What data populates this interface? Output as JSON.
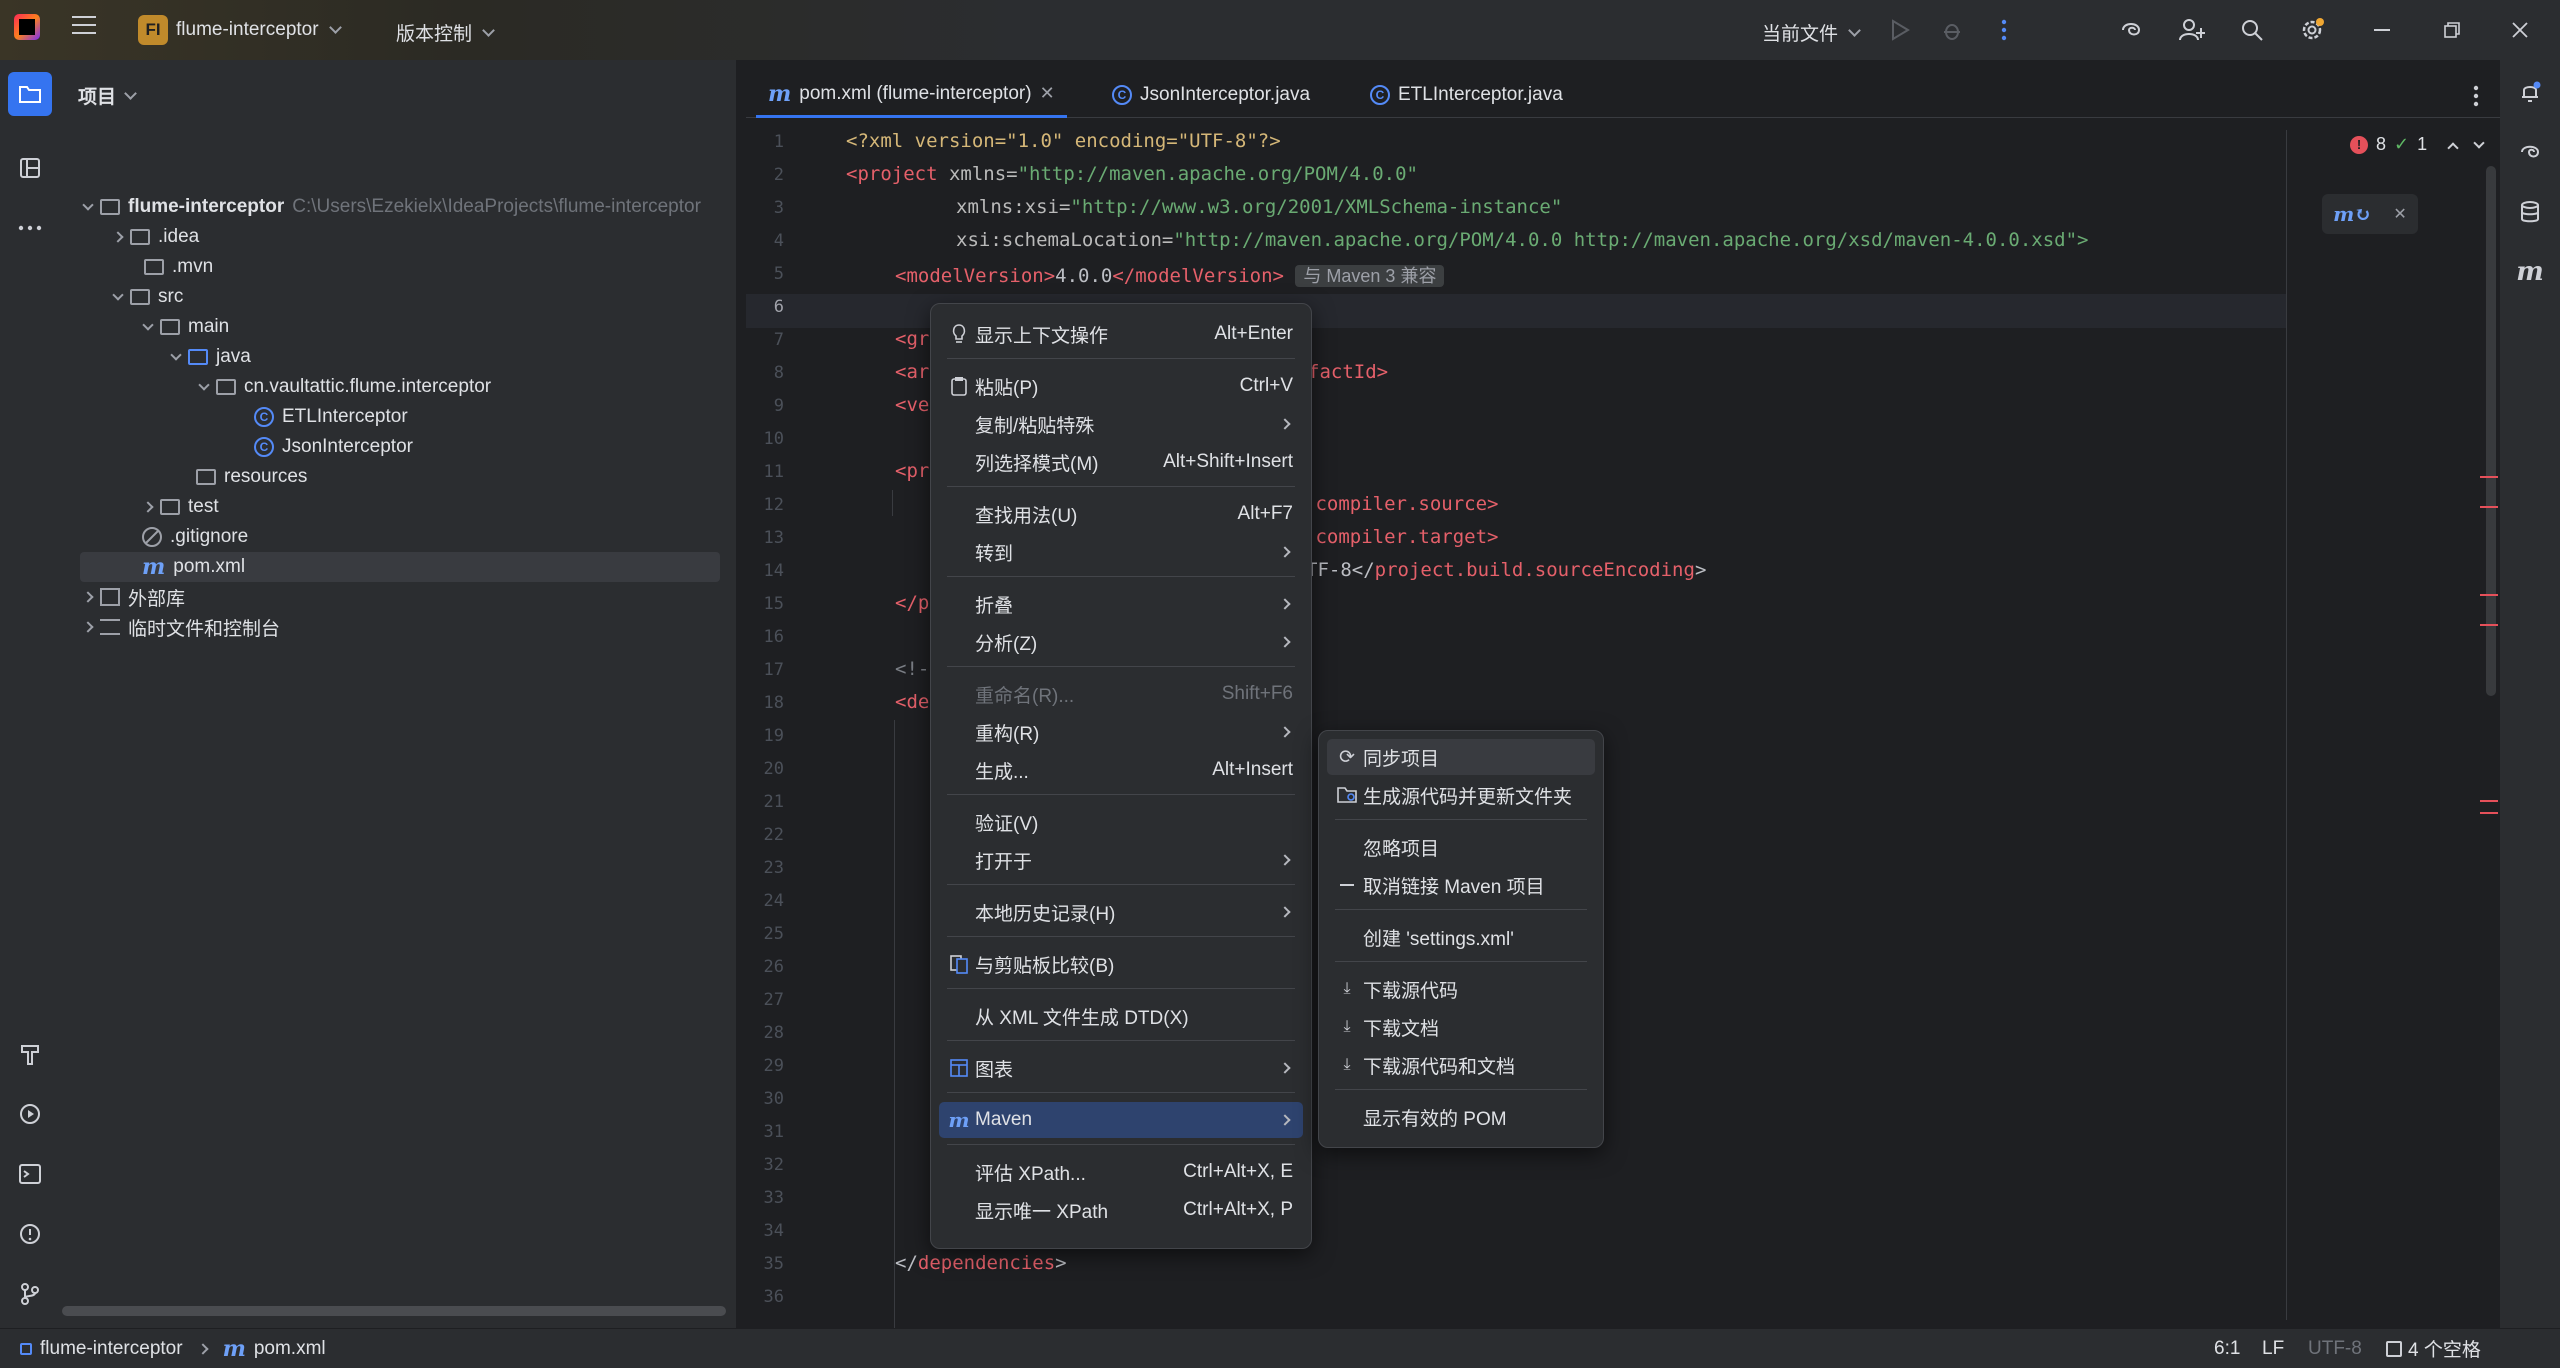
{
  "titlebar": {
    "project_badge": "FI",
    "project_name": "flume-interceptor",
    "vcs_label": "版本控制",
    "run_config": "当前文件"
  },
  "project_panel": {
    "header": "项目",
    "tree": [
      {
        "label": "flume-interceptor",
        "extra": "C:\\Users\\Ezekielx\\IdeaProjects\\flume-interceptor"
      },
      {
        "label": ".idea"
      },
      {
        "label": ".mvn"
      },
      {
        "label": "src"
      },
      {
        "label": "main"
      },
      {
        "label": "java"
      },
      {
        "label": "cn.vaultattic.flume.interceptor"
      },
      {
        "label": "ETLInterceptor"
      },
      {
        "label": "JsonInterceptor"
      },
      {
        "label": "resources"
      },
      {
        "label": "test"
      },
      {
        "label": ".gitignore"
      },
      {
        "label": "pom.xml"
      },
      {
        "label": "外部库"
      },
      {
        "label": "临时文件和控制台"
      }
    ]
  },
  "tabs": [
    {
      "label": "pom.xml (flume-interceptor)"
    },
    {
      "label": "JsonInterceptor.java"
    },
    {
      "label": "ETLInterceptor.java"
    }
  ],
  "editor": {
    "error_count": "8",
    "warn_count": "1",
    "maven_hint": "与 Maven 3 兼容",
    "lines": {
      "l1": "<?xml version=\"1.0\" encoding=\"UTF-8\"?>",
      "l2a": "<project ",
      "l2b": "xmlns=",
      "l2c": "\"http://maven.apache.org/POM/4.0.0\"",
      "l3b": "xmlns:xsi=",
      "l3c": "\"http://www.w3.org/2001/XMLSchema-instance\"",
      "l4b": "xsi:schemaLocation=",
      "l4c": "\"http://maven.apache.org/POM/4.0.0 http://maven.apache.org/xsd/maven-4.0.0.xsd\">",
      "l5a": "<modelVersion>",
      "l5b": "4.0.0",
      "l5c": "</modelVersion>",
      "l7": "<gr",
      "l8a": "<ar",
      "l8b": "factId>",
      "l9": "<ve",
      "l11": "<pr",
      "l12": ".compiler.source>",
      "l13": ".compiler.target>",
      "l14a": "TF-8</",
      "l14b": "project.build.sourceEncoding",
      "l14c": ">",
      "l15": "</p",
      "l17": "<!-",
      "l18": "<de",
      "l35a": "</",
      "l35b": "dependencies",
      "l35c": ">"
    }
  },
  "context_menu": {
    "items": [
      {
        "label": "显示上下文操作",
        "shortcut": "Alt+Enter"
      },
      {
        "label": "粘贴(P)",
        "shortcut": "Ctrl+V"
      },
      {
        "label": "复制/粘贴特殊"
      },
      {
        "label": "列选择模式(M)",
        "shortcut": "Alt+Shift+Insert"
      },
      {
        "label": "查找用法(U)",
        "shortcut": "Alt+F7"
      },
      {
        "label": "转到"
      },
      {
        "label": "折叠"
      },
      {
        "label": "分析(Z)"
      },
      {
        "label": "重命名(R)...",
        "shortcut": "Shift+F6"
      },
      {
        "label": "重构(R)"
      },
      {
        "label": "生成...",
        "shortcut": "Alt+Insert"
      },
      {
        "label": "验证(V)"
      },
      {
        "label": "打开于"
      },
      {
        "label": "本地历史记录(H)"
      },
      {
        "label": "与剪贴板比较(B)"
      },
      {
        "label": "从 XML 文件生成 DTD(X)"
      },
      {
        "label": "图表"
      },
      {
        "label": "Maven"
      },
      {
        "label": "评估 XPath...",
        "shortcut": "Ctrl+Alt+X, E"
      },
      {
        "label": "显示唯一 XPath",
        "shortcut": "Ctrl+Alt+X, P"
      }
    ]
  },
  "maven_submenu": {
    "items": [
      {
        "label": "同步项目"
      },
      {
        "label": "生成源代码并更新文件夹"
      },
      {
        "label": "忽略项目"
      },
      {
        "label": "取消链接 Maven 项目"
      },
      {
        "label": "创建 'settings.xml'"
      },
      {
        "label": "下载源代码"
      },
      {
        "label": "下载文档"
      },
      {
        "label": "下载源代码和文档"
      },
      {
        "label": "显示有效的 POM"
      }
    ]
  },
  "statusbar": {
    "crumb_project": "flume-interceptor",
    "crumb_file": "pom.xml",
    "position": "6:1",
    "line_sep": "LF",
    "encoding": "UTF-8",
    "indent": "4 个空格"
  }
}
